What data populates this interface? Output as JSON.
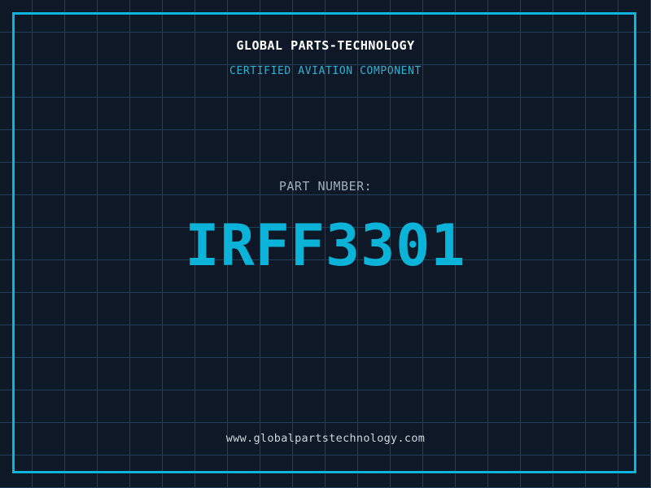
{
  "card": {
    "brand": "GLOBAL PARTS-TECHNOLOGY",
    "certification": "CERTIFIED AVIATION COMPONENT",
    "part_label": "PART NUMBER:",
    "part_number": "IRFF3301",
    "website": "www.globalpartstechnology.com"
  },
  "colors": {
    "background": "#0e1827",
    "grid_line": "#1c4257",
    "frame_border": "#0db5dc",
    "brand_text": "#ffffff",
    "certification_text": "#2fb2d2",
    "part_label_text": "#9fafbc",
    "part_number_text": "#0cb3d9",
    "website_text": "#ccd6dc"
  },
  "layout_meta": {
    "grid_cell_px": "40"
  }
}
